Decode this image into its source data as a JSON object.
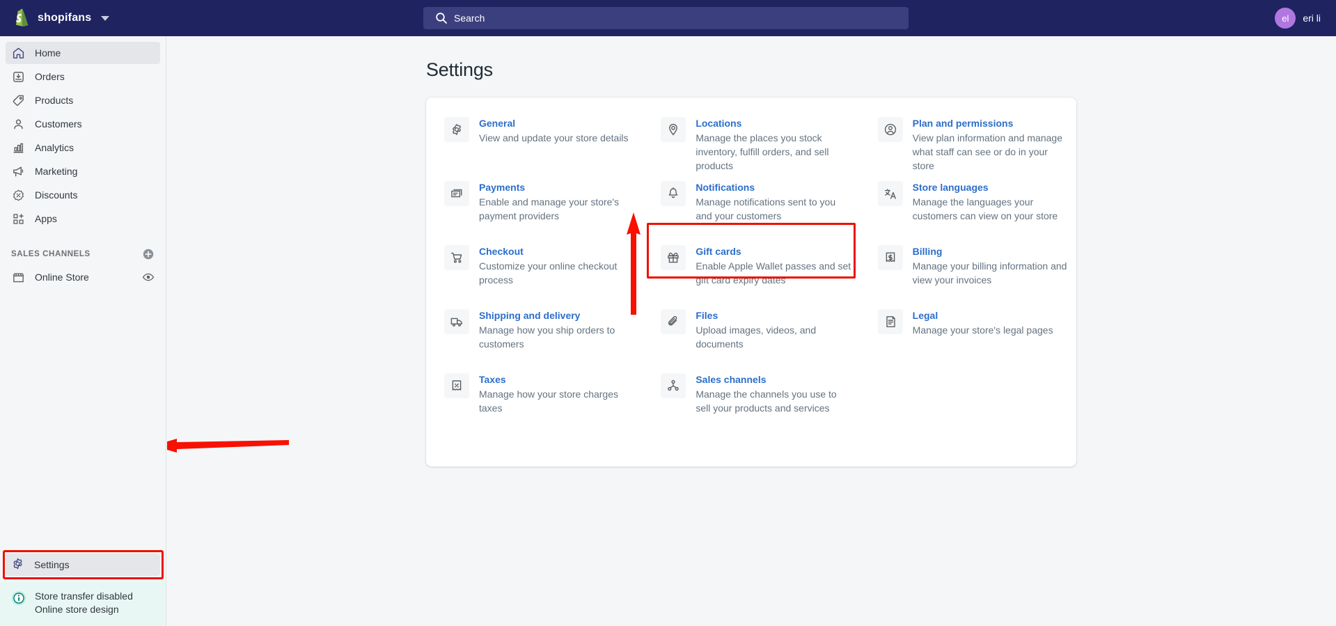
{
  "topbar": {
    "brand_name": "shopifans",
    "logo_icon": "shopify-bag-icon",
    "store_switcher_icon": "chevron-down-icon",
    "search": {
      "placeholder": "Search",
      "value": "",
      "icon": "search-icon"
    },
    "user": {
      "initials": "el",
      "name": "eri li"
    }
  },
  "sidebar": {
    "items": [
      {
        "label": "Home",
        "icon": "home-icon",
        "active": true
      },
      {
        "label": "Orders",
        "icon": "orders-inbox-icon",
        "active": false
      },
      {
        "label": "Products",
        "icon": "product-tag-icon",
        "active": false
      },
      {
        "label": "Customers",
        "icon": "customer-person-icon",
        "active": false
      },
      {
        "label": "Analytics",
        "icon": "analytics-bar-chart-icon",
        "active": false
      },
      {
        "label": "Marketing",
        "icon": "marketing-megaphone-icon",
        "active": false
      },
      {
        "label": "Discounts",
        "icon": "discount-percent-icon",
        "active": false
      },
      {
        "label": "Apps",
        "icon": "apps-grid-plus-icon",
        "active": false
      }
    ],
    "sales_channels": {
      "title": "SALES CHANNELS",
      "add_icon": "plus-circle-icon",
      "channels": [
        {
          "label": "Online Store",
          "icon": "storefront-icon",
          "action_icon": "eye-view-icon"
        }
      ]
    },
    "settings": {
      "label": "Settings",
      "icon": "gear-icon",
      "active": true,
      "highlighted": true
    },
    "notice": {
      "icon": "info-circle-icon",
      "line1": "Store transfer disabled",
      "line2": "Online store design"
    }
  },
  "main": {
    "page_title": "Settings",
    "settings_items": [
      {
        "title": "General",
        "desc": "View and update your store details",
        "icon": "gear-icon",
        "highlighted": false
      },
      {
        "title": "Locations",
        "desc": "Manage the places you stock inventory, fulfill orders, and sell products",
        "icon": "location-pin-icon",
        "highlighted": false
      },
      {
        "title": "Plan and permissions",
        "desc": "View plan information and manage what staff can see or do in your store",
        "icon": "profile-circle-icon",
        "highlighted": false
      },
      {
        "title": "Payments",
        "desc": "Enable and manage your store's payment providers",
        "icon": "payment-card-icon",
        "highlighted": false
      },
      {
        "title": "Notifications",
        "desc": "Manage notifications sent to you and your customers",
        "icon": "bell-icon",
        "highlighted": true
      },
      {
        "title": "Store languages",
        "desc": "Manage the languages your customers can view on your store",
        "icon": "language-translate-icon",
        "highlighted": false
      },
      {
        "title": "Checkout",
        "desc": "Customize your online checkout process",
        "icon": "shopping-cart-icon",
        "highlighted": false
      },
      {
        "title": "Gift cards",
        "desc": "Enable Apple Wallet passes and set gift card expiry dates",
        "icon": "gift-icon",
        "highlighted": false
      },
      {
        "title": "Billing",
        "desc": "Manage your billing information and view your invoices",
        "icon": "billing-receipt-icon",
        "highlighted": false
      },
      {
        "title": "Shipping and delivery",
        "desc": "Manage how you ship orders to customers",
        "icon": "delivery-truck-icon",
        "highlighted": false
      },
      {
        "title": "Files",
        "desc": "Upload images, videos, and documents",
        "icon": "paperclip-icon",
        "highlighted": false
      },
      {
        "title": "Legal",
        "desc": "Manage your store's legal pages",
        "icon": "legal-document-icon",
        "highlighted": false
      },
      {
        "title": "Taxes",
        "desc": "Manage how your store charges taxes",
        "icon": "tax-receipt-percent-icon",
        "highlighted": false
      },
      {
        "title": "Sales channels",
        "desc": "Manage the channels you use to sell your products and services",
        "icon": "sales-channel-network-icon",
        "highlighted": false
      }
    ]
  },
  "annotations": {
    "highlight_color": "#f00f00",
    "arrows": [
      {
        "name": "arrow-to-settings",
        "direction": "left",
        "target": "Settings"
      },
      {
        "name": "arrow-to-notifications",
        "direction": "up",
        "target": "Notifications"
      }
    ]
  },
  "colors": {
    "topbar_bg": "#1f2360",
    "link_blue": "#2c6ecb",
    "avatar_bg": "#b177e0",
    "page_bg": "#f4f6f8",
    "annotation_red": "#f00f00"
  }
}
